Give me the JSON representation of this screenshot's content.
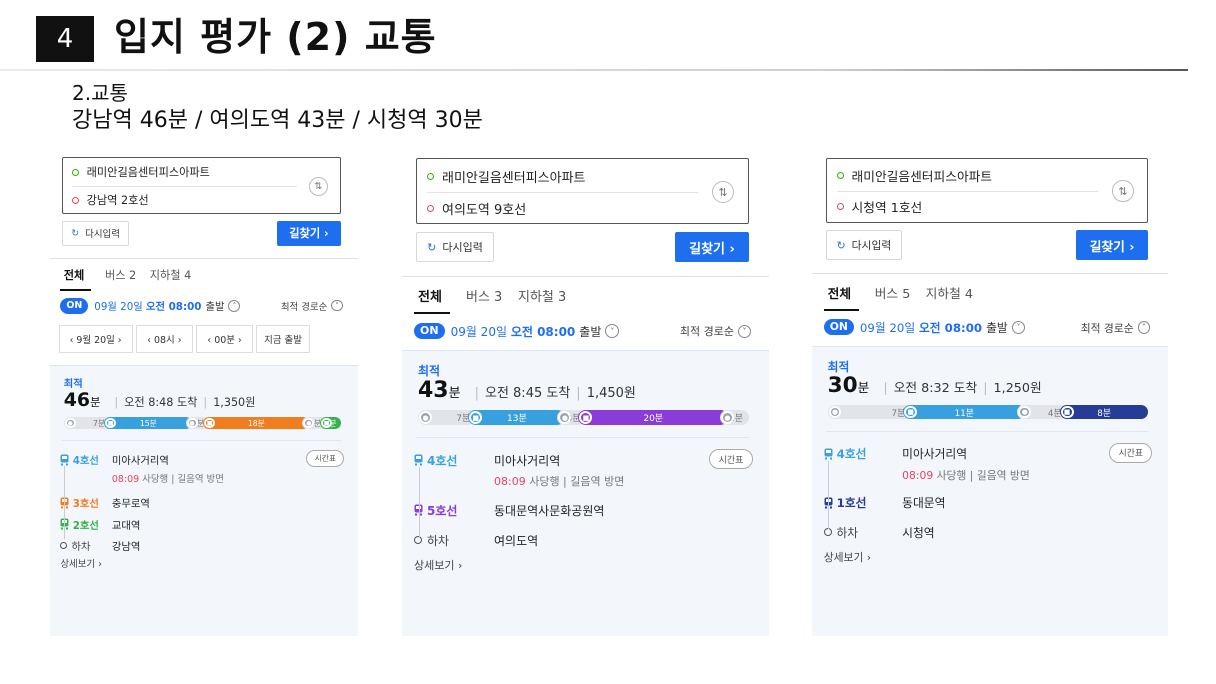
{
  "slide": {
    "number": "4",
    "title": "입지 평가 (2) 교통",
    "subtitle": "2.교통",
    "summary": "강남역 46분 / 여의도역 43분 / 시청역 30분"
  },
  "colors": {
    "blue": "#1e6ff0",
    "line4": "#39a0e0",
    "line3": "#f07d1e",
    "line2": "#35b24a",
    "line5": "#8a3bd8",
    "line1": "#263c96"
  },
  "common": {
    "origin": "래미안길음센터피스아파트",
    "reset_label": "다시입력",
    "go_label": "길찾기 ›",
    "tab_all": "전체",
    "on_badge": "ON",
    "time_date": "09월 20일",
    "time_ampm": "오전 08:00",
    "time_dep": "출발",
    "sort_label": "최적 경로순",
    "best_label": "최적",
    "min_unit": "분",
    "timetable_label": "시간표",
    "detail_label": "상세보기 ›",
    "alight_label": "하차"
  },
  "panels": [
    {
      "destination": "강남역 2호선",
      "tab_bus": "버스 2",
      "tab_subway": "지하철 4",
      "pickers": [
        "‹  9월 20일  ›",
        "‹  08시  ›",
        "‹  00분  ›",
        "지금 출발"
      ],
      "total_min": "46",
      "arrival": "오전 8:48 도착",
      "fare": "1,350원",
      "bar": [
        {
          "label": "7분",
          "type": "walk",
          "minutes": 7
        },
        {
          "label": "15분",
          "type": "line4",
          "minutes": 15
        },
        {
          "label": "1분",
          "type": "walk",
          "minutes": 1
        },
        {
          "label": "18분",
          "type": "line3",
          "minutes": 18
        },
        {
          "label": "2분",
          "type": "walk",
          "minutes": 2
        },
        {
          "label": "2분",
          "type": "line2",
          "minutes": 2
        }
      ],
      "steps": [
        {
          "line": "4호선",
          "type": "line4",
          "station": "미아사거리역",
          "sub_dep": "08:09",
          "sub_text": " 사당행 | 길음역 방면",
          "timetable": true
        },
        {
          "line": "3호선",
          "type": "line3",
          "station": "충무로역"
        },
        {
          "line": "2호선",
          "type": "line2",
          "station": "교대역"
        },
        {
          "line": "하차",
          "type": "alight",
          "station": "강남역"
        }
      ]
    },
    {
      "destination": "여의도역 9호선",
      "tab_bus": "버스 3",
      "tab_subway": "지하철 3",
      "total_min": "43",
      "arrival": "오전 8:45 도착",
      "fare": "1,450원",
      "bar": [
        {
          "label": "7분",
          "type": "walk",
          "minutes": 7
        },
        {
          "label": "13분",
          "type": "line4",
          "minutes": 13
        },
        {
          "label": "3분",
          "type": "walk",
          "minutes": 3
        },
        {
          "label": "20분",
          "type": "line5",
          "minutes": 20
        },
        {
          "label": "1분",
          "type": "walk",
          "minutes": 1
        }
      ],
      "steps": [
        {
          "line": "4호선",
          "type": "line4",
          "station": "미아사거리역",
          "sub_dep": "08:09",
          "sub_text": " 사당행 | 길음역 방면",
          "timetable": true
        },
        {
          "line": "5호선",
          "type": "line5",
          "station": "동대문역사문화공원역"
        },
        {
          "line": "하차",
          "type": "alight",
          "station": "여의도역"
        }
      ]
    },
    {
      "destination": "시청역 1호선",
      "tab_bus": "버스 5",
      "tab_subway": "지하철 4",
      "total_min": "30",
      "arrival": "오전 8:32 도착",
      "fare": "1,250원",
      "bar": [
        {
          "label": "7분",
          "type": "walk",
          "minutes": 7
        },
        {
          "label": "11분",
          "type": "line4",
          "minutes": 11
        },
        {
          "label": "4분",
          "type": "walk",
          "minutes": 4
        },
        {
          "label": "8분",
          "type": "line1",
          "minutes": 8
        }
      ],
      "steps": [
        {
          "line": "4호선",
          "type": "line4",
          "station": "미아사거리역",
          "sub_dep": "08:09",
          "sub_text": " 사당행 | 길음역 방면",
          "timetable": true
        },
        {
          "line": "1호선",
          "type": "line1",
          "station": "동대문역"
        },
        {
          "line": "하차",
          "type": "alight",
          "station": "시청역"
        }
      ]
    }
  ]
}
